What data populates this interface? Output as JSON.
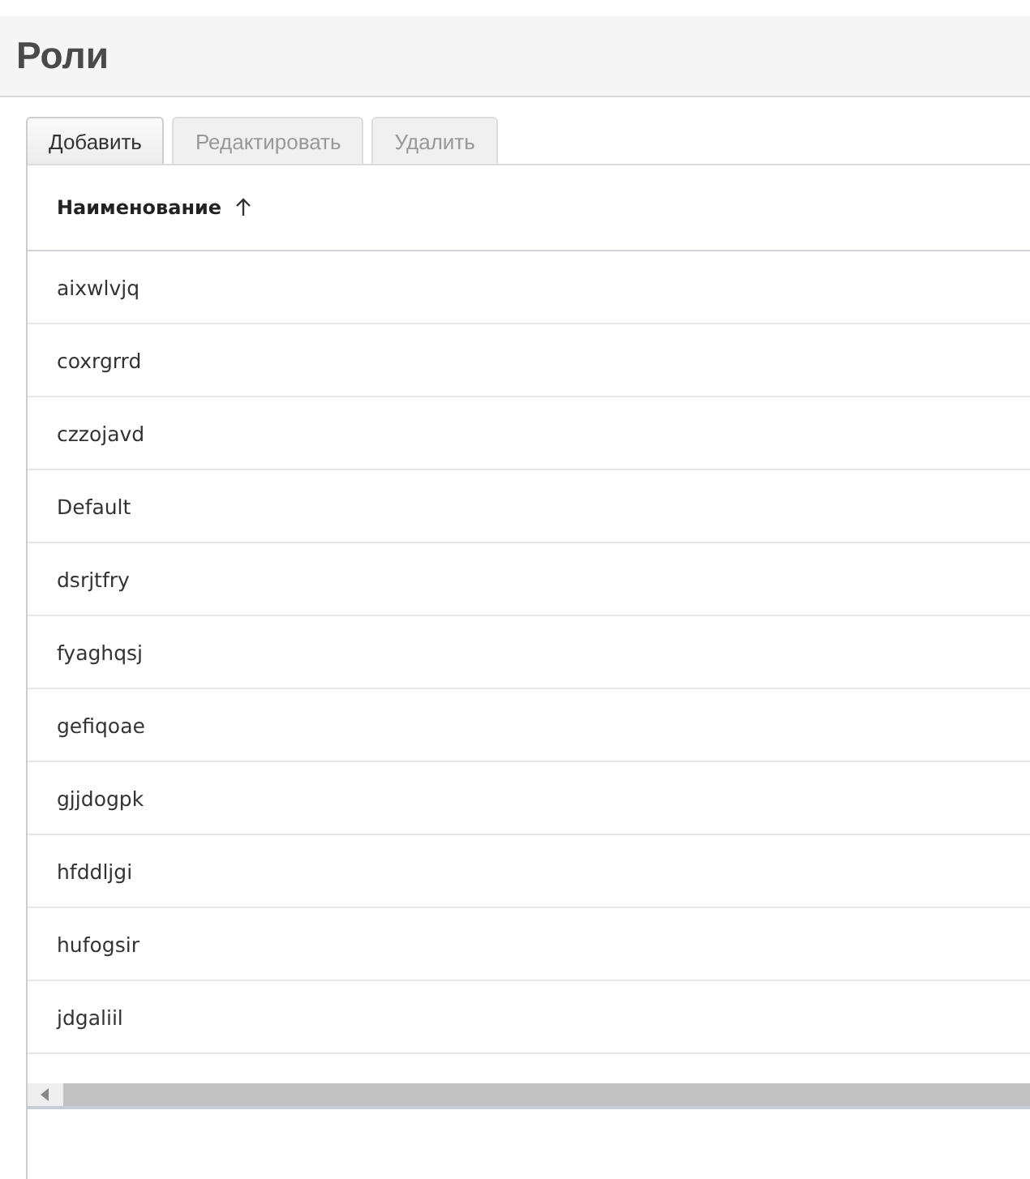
{
  "page": {
    "title": "Роли"
  },
  "toolbar": [
    {
      "label": "Добавить",
      "disabled": false
    },
    {
      "label": "Редактировать",
      "disabled": true
    },
    {
      "label": "Удалить",
      "disabled": true
    }
  ],
  "table": {
    "columns": [
      {
        "label": "Наименование",
        "sort_ascending": true
      }
    ],
    "rows": [
      {
        "cells": [
          "aixwlvjq"
        ]
      },
      {
        "cells": [
          "coxrgrrd"
        ]
      },
      {
        "cells": [
          "czzojavd"
        ]
      },
      {
        "cells": [
          "Default"
        ]
      },
      {
        "cells": [
          "dsrjtfry"
        ]
      },
      {
        "cells": [
          "fyaghqsj"
        ]
      },
      {
        "cells": [
          "gefiqoae"
        ]
      },
      {
        "cells": [
          "gjjdogpk"
        ]
      },
      {
        "cells": [
          "hfddljgi"
        ]
      },
      {
        "cells": [
          "hufogsir"
        ]
      },
      {
        "cells": [
          "jdgaliil"
        ]
      }
    ]
  }
}
